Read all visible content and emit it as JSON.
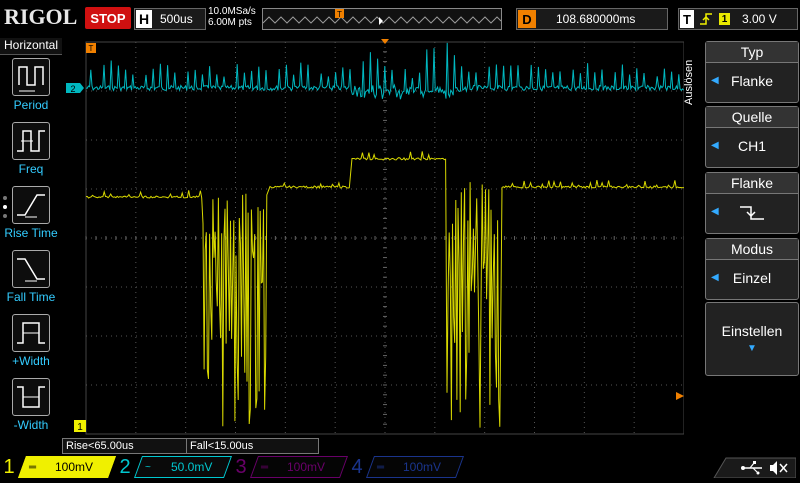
{
  "header": {
    "logo": "RIGOL",
    "run_state": "STOP",
    "h_letter": "H",
    "timebase": "500us",
    "sample_rate": "10.0MSa/s",
    "memory_depth": "6.00M pts",
    "delay_letter": "D",
    "delay_value": "108.680000ms",
    "trig_letter": "T",
    "trig_source_num": "1",
    "trig_level": "3.00 V"
  },
  "left_menu": {
    "title": "Horizontal",
    "items": [
      {
        "label": "Period",
        "icon": "period-icon"
      },
      {
        "label": "Freq",
        "icon": "freq-icon"
      },
      {
        "label": "Rise Time",
        "icon": "rise-time-icon"
      },
      {
        "label": "Fall Time",
        "icon": "fall-time-icon"
      },
      {
        "label": "+Width",
        "icon": "pos-width-icon"
      },
      {
        "label": "-Width",
        "icon": "neg-width-icon"
      }
    ]
  },
  "right_menu": {
    "side_label": "Auslösen",
    "items": [
      {
        "title": "Typ",
        "value": "Flanke"
      },
      {
        "title": "Quelle",
        "value": "CH1"
      },
      {
        "title": "Flanke",
        "value": ""
      },
      {
        "title": "Modus",
        "value": "Einzel"
      },
      {
        "title": "Einstellen",
        "value": ""
      }
    ]
  },
  "measurements": {
    "rise": "Rise<65.00us",
    "fall": "Fall<15.00us"
  },
  "markers": {
    "ch1": "1",
    "ch2": "2",
    "trigger": "T"
  },
  "channels": [
    {
      "num": "1",
      "coupling": "DC",
      "scale": "100mV",
      "color": "#f0f000",
      "active": true
    },
    {
      "num": "2",
      "coupling": "AC",
      "scale": "50.0mV",
      "color": "#00c8d0",
      "active": true
    },
    {
      "num": "3",
      "coupling": "DC",
      "scale": "100mV",
      "color": "#c000c0",
      "active": false
    },
    {
      "num": "4",
      "coupling": "DC",
      "scale": "100mV",
      "color": "#3060ff",
      "active": false
    }
  ],
  "colors": {
    "ch1": "#e0e000",
    "ch2": "#00b8c0",
    "trigger": "#f08000",
    "grid": "#555555"
  }
}
